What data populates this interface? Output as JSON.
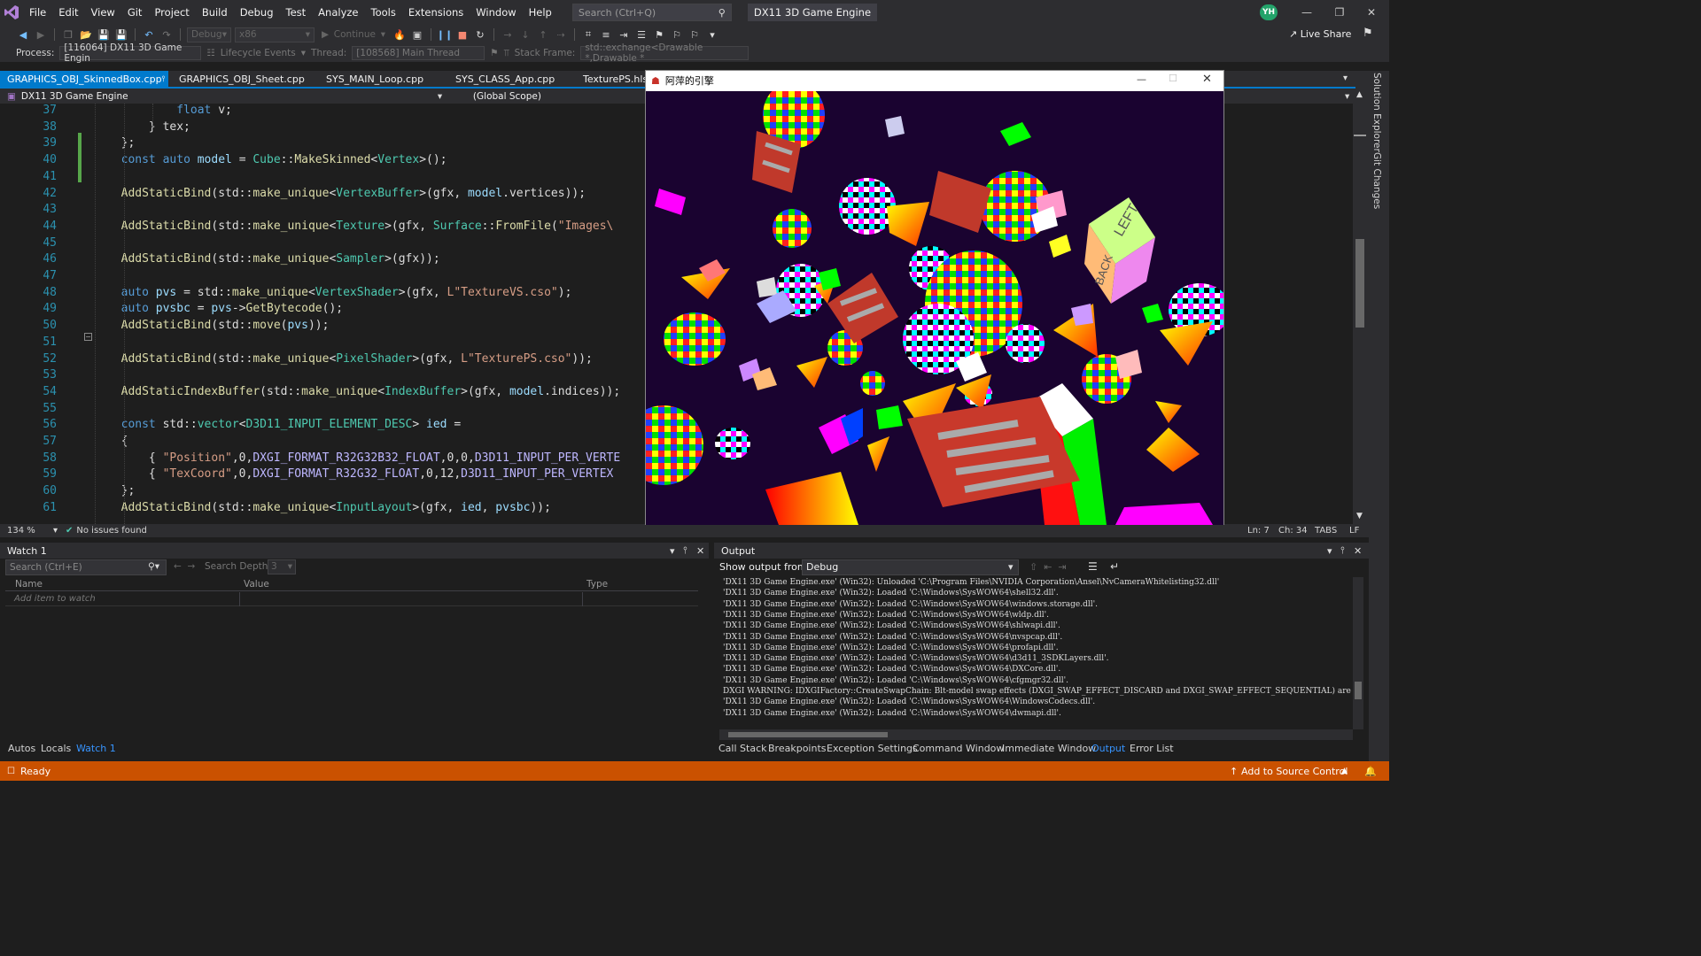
{
  "menu": {
    "items": [
      "File",
      "Edit",
      "View",
      "Git",
      "Project",
      "Build",
      "Debug",
      "Test",
      "Analyze",
      "Tools",
      "Extensions",
      "Window",
      "Help"
    ],
    "search_placeholder": "Search (Ctrl+Q)",
    "app_title": "DX11 3D Game Engine",
    "avatar_initials": "YH"
  },
  "toolbar": {
    "config": "Debug",
    "platform": "x86",
    "continue_label": "Continue",
    "live_share": "Live Share"
  },
  "processbar": {
    "process_label": "Process:",
    "process_value": "[116064] DX11 3D Game Engin",
    "lifecycle": "Lifecycle Events",
    "thread_label": "Thread:",
    "thread_value": "[108568] Main Thread",
    "stack_label": "Stack Frame:",
    "stack_value": "std::exchange<Drawable *,Drawable *"
  },
  "tabs": [
    {
      "label": "GRAPHICS_OBJ_SkinnedBox.cpp",
      "active": true
    },
    {
      "label": "GRAPHICS_OBJ_Sheet.cpp",
      "active": false
    },
    {
      "label": "SYS_MAIN_Loop.cpp",
      "active": false
    },
    {
      "label": "SYS_CLASS_App.cpp",
      "active": false
    },
    {
      "label": "TexturePS.hlsl",
      "active": false
    }
  ],
  "navbar": {
    "project": "DX11 3D Game Engine",
    "scope": "(Global Scope)"
  },
  "code_lines": [
    {
      "n": "37",
      "html": "            <span class='kw'>float</span> v;"
    },
    {
      "n": "38",
      "html": "        } tex;"
    },
    {
      "n": "39",
      "html": "    };"
    },
    {
      "n": "40",
      "html": "    <span class='kw'>const auto</span> <span class='var'>model</span> = <span class='ty'>Cube</span>::<span class='fn'>MakeSkinned</span>&lt;<span class='ty'>Vertex</span>&gt;();"
    },
    {
      "n": "41",
      "html": ""
    },
    {
      "n": "42",
      "html": "    <span class='fn'>AddStaticBind</span>(std::<span class='fn'>make_unique</span>&lt;<span class='ty'>VertexBuffer</span>&gt;(gfx, <span class='var'>model</span>.vertices));"
    },
    {
      "n": "43",
      "html": ""
    },
    {
      "n": "44",
      "html": "    <span class='fn'>AddStaticBind</span>(std::<span class='fn'>make_unique</span>&lt;<span class='ty'>Texture</span>&gt;(gfx, <span class='ty'>Surface</span>::<span class='fn'>FromFile</span>(<span class='str'>\"Images\\</span>"
    },
    {
      "n": "45",
      "html": ""
    },
    {
      "n": "46",
      "html": "    <span class='fn'>AddStaticBind</span>(std::<span class='fn'>make_unique</span>&lt;<span class='ty'>Sampler</span>&gt;(gfx));"
    },
    {
      "n": "47",
      "html": ""
    },
    {
      "n": "48",
      "html": "    <span class='kw'>auto</span> <span class='var'>pvs</span> = std::<span class='fn'>make_unique</span>&lt;<span class='ty'>VertexShader</span>&gt;(gfx, <span class='str'>L\"TextureVS.cso\"</span>);"
    },
    {
      "n": "49",
      "html": "    <span class='kw'>auto</span> <span class='var'>pvsbc</span> = <span class='var'>pvs</span>-&gt;<span class='fn'>GetBytecode</span>();"
    },
    {
      "n": "50",
      "html": "    <span class='fn'>AddStaticBind</span>(std::<span class='fn'>move</span>(<span class='var'>pvs</span>));"
    },
    {
      "n": "51",
      "html": ""
    },
    {
      "n": "52",
      "html": "    <span class='fn'>AddStaticBind</span>(std::<span class='fn'>make_unique</span>&lt;<span class='ty'>PixelShader</span>&gt;(gfx, <span class='str'>L\"TexturePS.cso\"</span>));"
    },
    {
      "n": "53",
      "html": ""
    },
    {
      "n": "54",
      "html": "    <span class='fn'>AddStaticIndexBuffer</span>(std::<span class='fn'>make_unique</span>&lt;<span class='ty'>IndexBuffer</span>&gt;(gfx, <span class='var'>model</span>.indices));"
    },
    {
      "n": "55",
      "html": ""
    },
    {
      "n": "56",
      "html": "    <span class='kw'>const</span> std::<span class='ty'>vector</span>&lt;<span class='ty'>D3D11_INPUT_ELEMENT_DESC</span>&gt; <span class='var'>ied</span> ="
    },
    {
      "n": "57",
      "html": "    {"
    },
    {
      "n": "58",
      "html": "        { <span class='str'>\"Position\"</span>,0,<span class='mac'>DXGI_FORMAT_R32G32B32_FLOAT</span>,0,0,<span class='mac'>D3D11_INPUT_PER_VERTE</span>"
    },
    {
      "n": "59",
      "html": "        { <span class='str'>\"TexCoord\"</span>,0,<span class='mac'>DXGI_FORMAT_R32G32_FLOAT</span>,0,12,<span class='mac'>D3D11_INPUT_PER_VERTEX</span>"
    },
    {
      "n": "60",
      "html": "    };"
    },
    {
      "n": "61",
      "html": "    <span class='fn'>AddStaticBind</span>(std::<span class='fn'>make_unique</span>&lt;<span class='ty'>InputLayout</span>&gt;(gfx, <span class='var'>ied</span>, <span class='var'>pvsbc</span>));"
    }
  ],
  "editor_status": {
    "zoom": "134 %",
    "issues": "No issues found",
    "line": "Ln: 7",
    "col": "Ch: 34",
    "tabs": "TABS",
    "eol": "LF"
  },
  "game_window": {
    "title": "阿萍的引擎"
  },
  "side": {
    "solution_explorer": "Solution Explorer",
    "git_changes": "Git Changes"
  },
  "watch": {
    "title": "Watch 1",
    "search_placeholder": "Search (Ctrl+E)",
    "search_depth_label": "Search Depth:",
    "search_depth_value": "3",
    "col_name": "Name",
    "col_value": "Value",
    "col_type": "Type",
    "add_item": "Add item to watch"
  },
  "output": {
    "title": "Output",
    "show_from_label": "Show output from:",
    "show_from_value": "Debug",
    "lines": [
      "'DX11 3D Game Engine.exe' (Win32): Unloaded 'C:\\Program Files\\NVIDIA Corporation\\Ansel\\NvCameraWhitelisting32.dll'",
      "'DX11 3D Game Engine.exe' (Win32): Loaded 'C:\\Windows\\SysWOW64\\shell32.dll'.",
      "'DX11 3D Game Engine.exe' (Win32): Loaded 'C:\\Windows\\SysWOW64\\windows.storage.dll'.",
      "'DX11 3D Game Engine.exe' (Win32): Loaded 'C:\\Windows\\SysWOW64\\wldp.dll'.",
      "'DX11 3D Game Engine.exe' (Win32): Loaded 'C:\\Windows\\SysWOW64\\shlwapi.dll'.",
      "'DX11 3D Game Engine.exe' (Win32): Loaded 'C:\\Windows\\SysWOW64\\nvspcap.dll'.",
      "'DX11 3D Game Engine.exe' (Win32): Loaded 'C:\\Windows\\SysWOW64\\profapi.dll'.",
      "'DX11 3D Game Engine.exe' (Win32): Loaded 'C:\\Windows\\SysWOW64\\d3d11_3SDKLayers.dll'.",
      "'DX11 3D Game Engine.exe' (Win32): Loaded 'C:\\Windows\\SysWOW64\\DXCore.dll'.",
      "'DX11 3D Game Engine.exe' (Win32): Loaded 'C:\\Windows\\SysWOW64\\cfgmgr32.dll'.",
      "DXGI WARNING: IDXGIFactory::CreateSwapChain: Blt-model swap effects (DXGI_SWAP_EFFECT_DISCARD and DXGI_SWAP_EFFECT_SEQUENTIAL) are legacy swap ef",
      "'DX11 3D Game Engine.exe' (Win32): Loaded 'C:\\Windows\\SysWOW64\\WindowsCodecs.dll'.",
      "'DX11 3D Game Engine.exe' (Win32): Loaded 'C:\\Windows\\SysWOW64\\dwmapi.dll'."
    ]
  },
  "bottom_tabs_left": [
    "Autos",
    "Locals",
    "Watch 1"
  ],
  "bottom_tabs_right": [
    "Call Stack",
    "Breakpoints",
    "Exception Settings",
    "Command Window",
    "Immediate Window",
    "Output",
    "Error List"
  ],
  "statusbar": {
    "ready": "Ready",
    "source_control": "Add to Source Control"
  },
  "colors": {
    "accent": "#007acc",
    "status_bar": "#ca5100",
    "avatar": "#23a36a"
  }
}
